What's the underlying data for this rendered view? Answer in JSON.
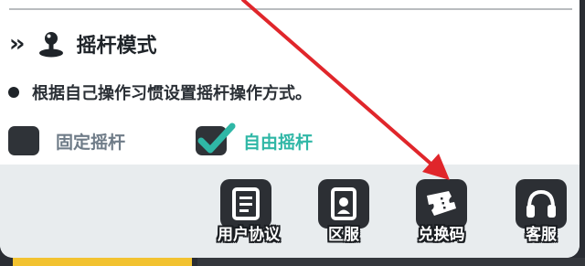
{
  "section": {
    "title": "摇杆模式",
    "description": "根据自己操作习惯设置摇杆操作方式。"
  },
  "options": {
    "fixed": {
      "label": "固定摇杆",
      "checked": false
    },
    "free": {
      "label": "自由摇杆",
      "checked": true
    }
  },
  "actions": [
    {
      "label": "用户协议",
      "icon": "document-icon"
    },
    {
      "label": "区服",
      "icon": "server-icon"
    },
    {
      "label": "兑换码",
      "icon": "ticket-icon"
    },
    {
      "label": "客服",
      "icon": "headset-icon"
    }
  ],
  "colors": {
    "accent_teal": "#2fb7a6",
    "annotation_arrow": "#e0262b",
    "bottom_yellow": "#f2c230"
  }
}
